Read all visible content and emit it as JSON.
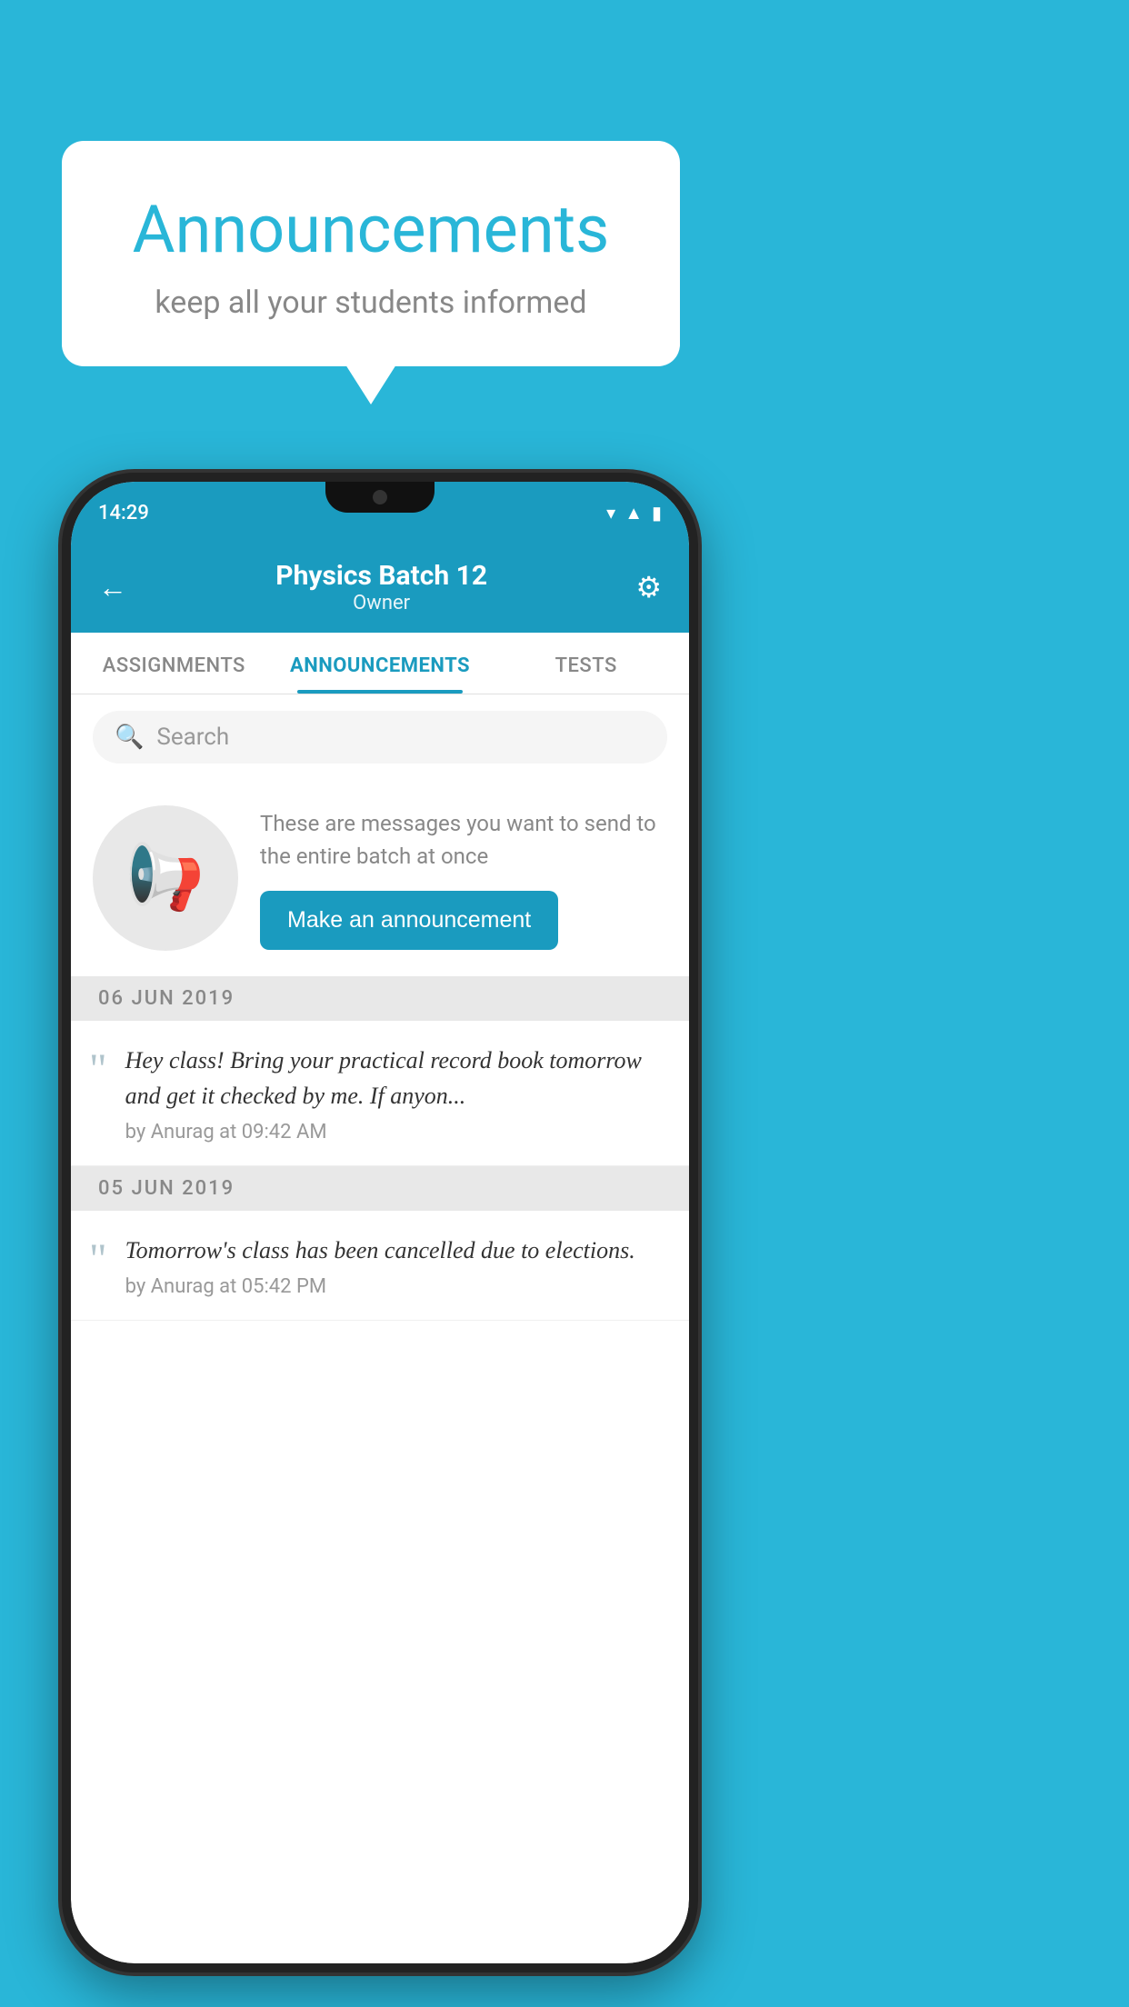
{
  "background_color": "#29b6d8",
  "speech_bubble": {
    "title": "Announcements",
    "subtitle": "keep all your students informed"
  },
  "phone": {
    "status_bar": {
      "time": "14:29",
      "wifi_icon": "wifi",
      "signal_icon": "signal",
      "battery_icon": "battery"
    },
    "header": {
      "back_label": "←",
      "title": "Physics Batch 12",
      "subtitle": "Owner",
      "settings_label": "⚙"
    },
    "tabs": [
      {
        "label": "ASSIGNMENTS",
        "active": false
      },
      {
        "label": "ANNOUNCEMENTS",
        "active": true
      },
      {
        "label": "TESTS",
        "active": false
      },
      {
        "label": "...",
        "active": false
      }
    ],
    "search": {
      "placeholder": "Search"
    },
    "promo": {
      "description_text": "These are messages you want to send to the entire batch at once",
      "button_label": "Make an announcement"
    },
    "announcements": [
      {
        "date": "06  JUN  2019",
        "text": "Hey class! Bring your practical record book tomorrow and get it checked by me. If anyon...",
        "meta": "by Anurag at 09:42 AM"
      },
      {
        "date": "05  JUN  2019",
        "text": "Tomorrow's class has been cancelled due to elections.",
        "meta": "by Anurag at 05:42 PM"
      }
    ]
  }
}
